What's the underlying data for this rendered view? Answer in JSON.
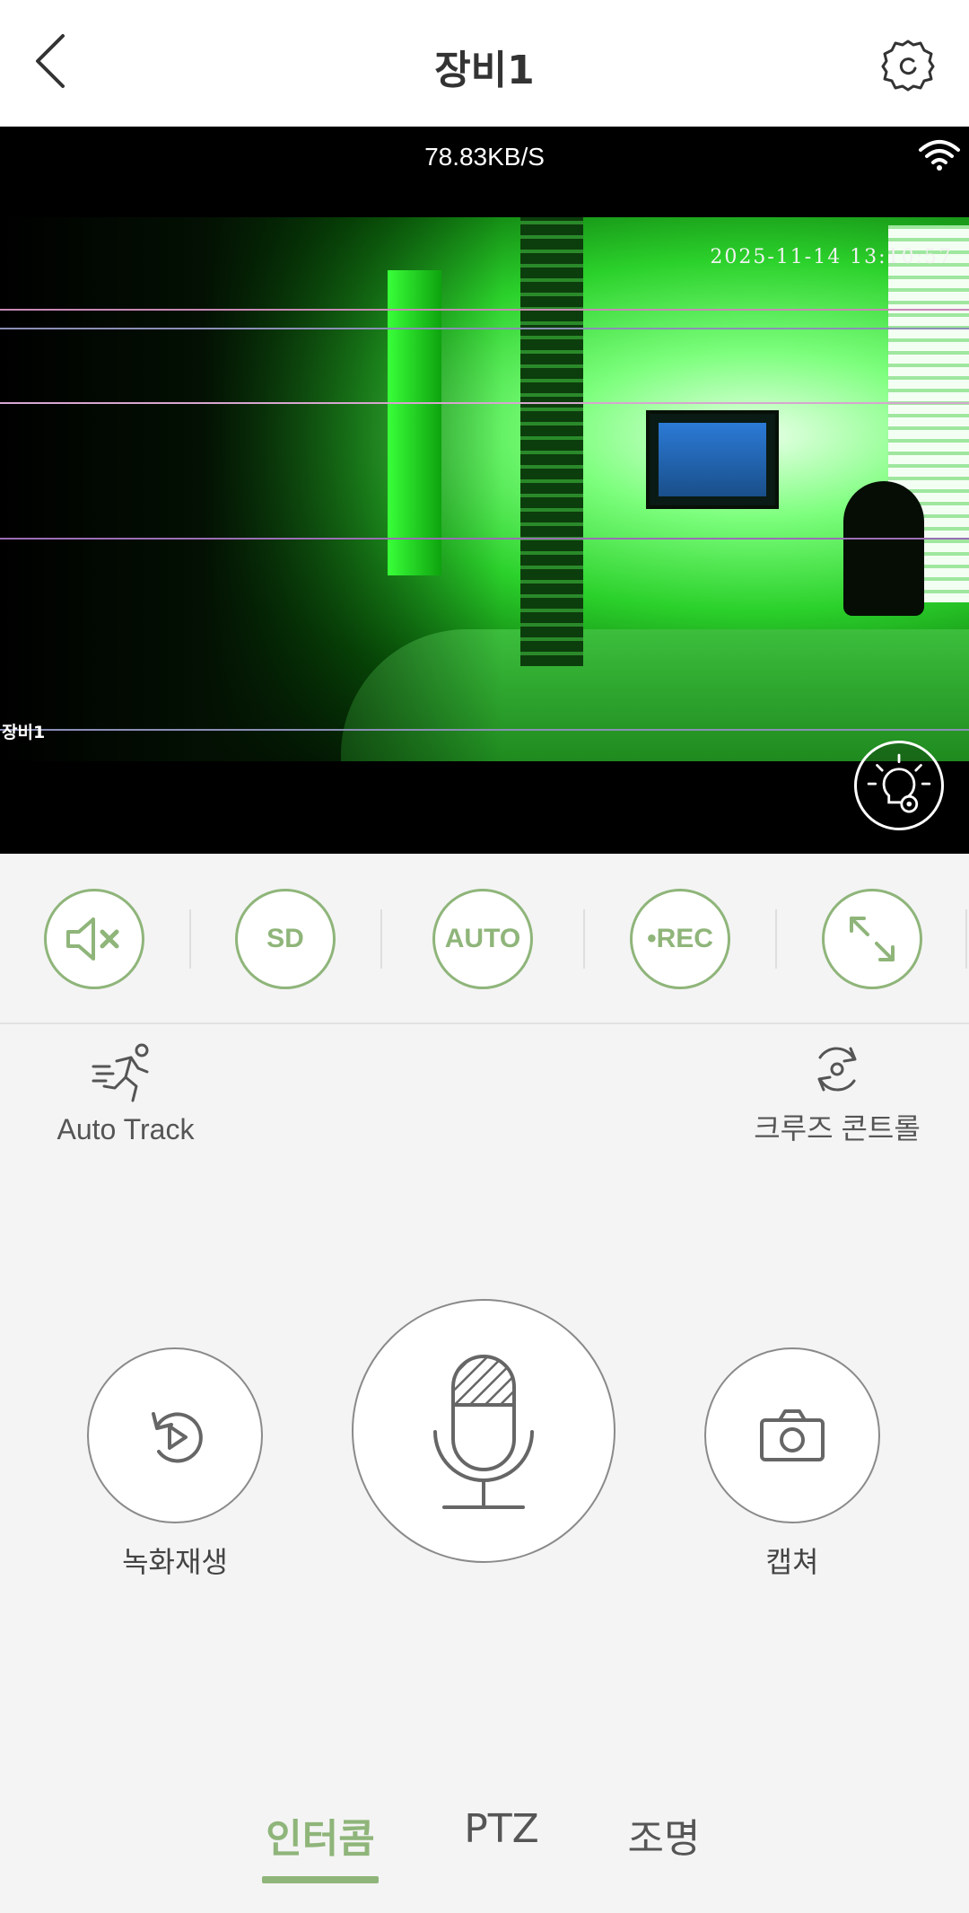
{
  "header": {
    "title": "장비1",
    "back_icon": "chevron-left-icon",
    "settings_icon": "gear-icon"
  },
  "video": {
    "bitrate": "78.83KB/S",
    "timestamp": "2025-11-14 13:10:57",
    "osd_name": "장비1",
    "wifi_icon": "wifi-icon",
    "light_icon": "light-settings-icon"
  },
  "controls": {
    "mute_icon": "speaker-muted-icon",
    "quality_label": "SD",
    "auto_label": "AUTO",
    "rec_label": "•REC",
    "fullscreen_icon": "expand-icon",
    "accent_color": "#8fb57a"
  },
  "features": {
    "auto_track_label": "Auto Track",
    "cruise_label": "크루즈 콘트롤"
  },
  "actions": {
    "playback_label": "녹화재생",
    "capture_label": "캡쳐"
  },
  "tabs": [
    {
      "label": "인터콤",
      "active": true
    },
    {
      "label": "PTZ",
      "active": false
    },
    {
      "label": "조명",
      "active": false
    }
  ]
}
